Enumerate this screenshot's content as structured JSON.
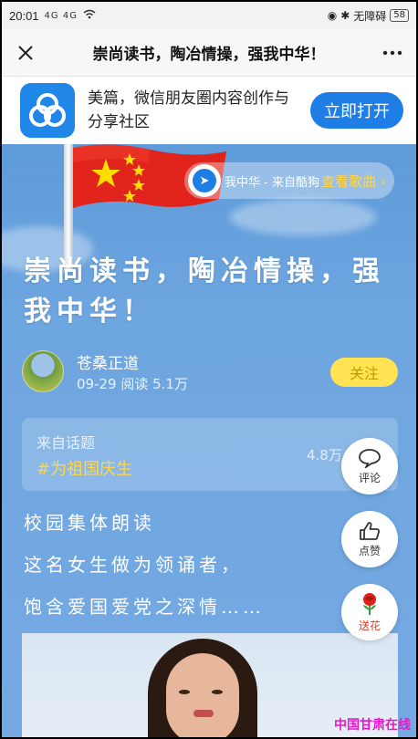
{
  "status_bar": {
    "time": "20:01",
    "signal_text": "4G 4G",
    "network_label": "无障碍",
    "battery": "58"
  },
  "navbar": {
    "title": "崇尚读书，陶冶情操，强我中华！",
    "close_icon": "close-icon",
    "more_icon": "more-icon"
  },
  "app_banner": {
    "description": "美篇，微信朋友圈内容创作与分享社区",
    "open_button": "立即打开"
  },
  "music": {
    "title": "我中华 - 来自酷狗",
    "link": "查看歌曲 ›"
  },
  "article": {
    "title": "崇尚读书，陶冶情操，强我中华！",
    "author_name": "苍桑正道",
    "meta": "09-29  阅读 5.1万",
    "follow_label": "关注",
    "topic_label": "来自话题",
    "topic_name": "#为祖国庆生",
    "topic_count": "4.8万",
    "lines": [
      "校园集体朗读",
      "这名女生做为领诵者，",
      "饱含爱国爱党之深情……"
    ]
  },
  "actions": {
    "comment": "评论",
    "like": "点赞",
    "flower": "送花"
  },
  "watermark": "中国甘肃在线",
  "colors": {
    "accent_blue": "#1e7ee6",
    "follow_yellow": "#ffe352",
    "topic_yellow": "#ffd64a",
    "watermark_magenta": "#e619c8"
  }
}
